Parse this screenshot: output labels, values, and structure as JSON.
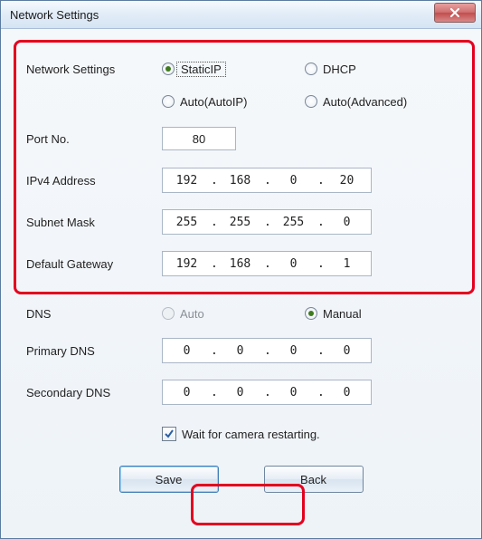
{
  "window": {
    "title": "Network Settings"
  },
  "labels": {
    "network_settings": "Network Settings",
    "port_no": "Port No.",
    "ipv4": "IPv4 Address",
    "subnet": "Subnet Mask",
    "gateway": "Default Gateway",
    "dns": "DNS",
    "primary_dns": "Primary DNS",
    "secondary_dns": "Secondary DNS",
    "wait_restart": "Wait for camera restarting."
  },
  "network_mode": {
    "static": "StaticIP",
    "dhcp": "DHCP",
    "autoip": "Auto(AutoIP)",
    "autoadv": "Auto(Advanced)",
    "selected": "static"
  },
  "port": "80",
  "ipv4": {
    "o1": "192",
    "o2": "168",
    "o3": "0",
    "o4": "20"
  },
  "subnet": {
    "o1": "255",
    "o2": "255",
    "o3": "255",
    "o4": "0"
  },
  "gateway": {
    "o1": "192",
    "o2": "168",
    "o3": "0",
    "o4": "1"
  },
  "dns_mode": {
    "auto": "Auto",
    "manual": "Manual",
    "selected": "manual"
  },
  "pdns": {
    "o1": "0",
    "o2": "0",
    "o3": "0",
    "o4": "0"
  },
  "sdns": {
    "o1": "0",
    "o2": "0",
    "o3": "0",
    "o4": "0"
  },
  "buttons": {
    "save": "Save",
    "back": "Back"
  }
}
